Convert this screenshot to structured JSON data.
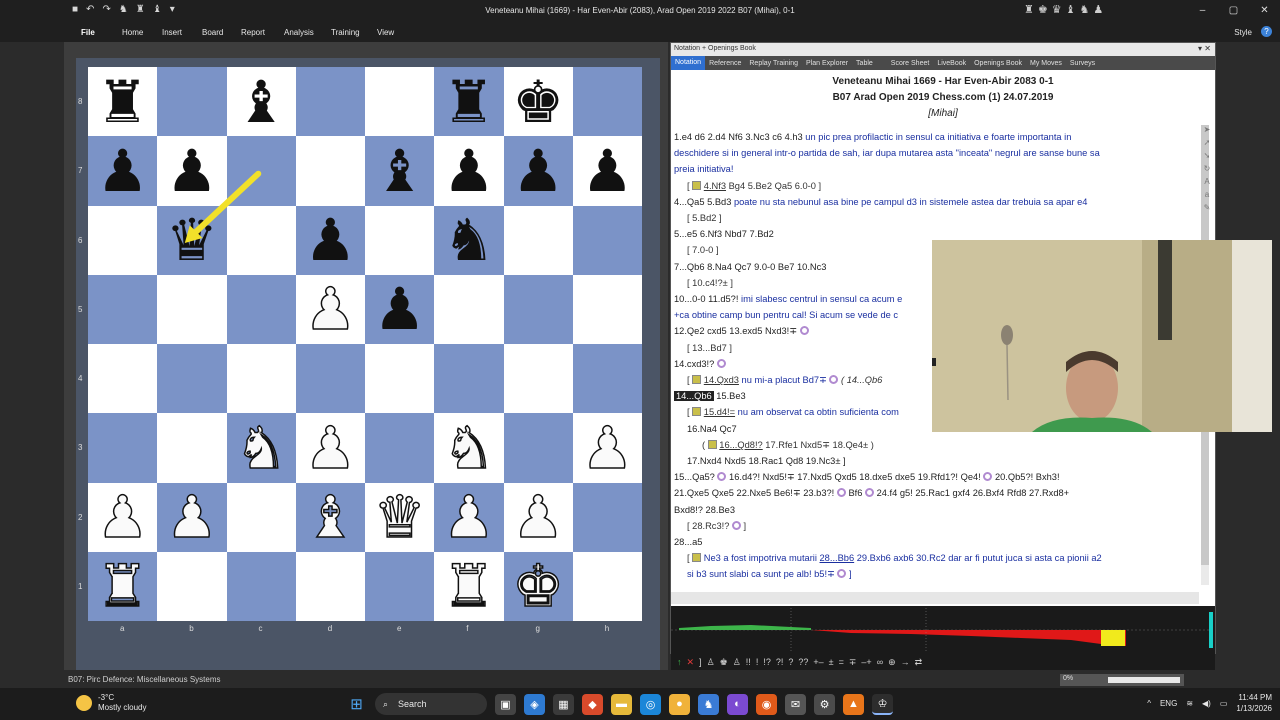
{
  "window": {
    "title": "Veneteanu Mihai (1669) - Har Even-Abir (2083), Arad Open 2019 2022 B07 (Mihai), 0-1",
    "controls": [
      "–",
      "▢",
      "✕"
    ]
  },
  "ribbon": {
    "file": "File",
    "tabs": [
      "Home",
      "Insert",
      "Board",
      "Report",
      "Analysis",
      "Training",
      "View"
    ],
    "style": "Style"
  },
  "board": {
    "files": [
      "a",
      "b",
      "c",
      "d",
      "e",
      "f",
      "g",
      "h"
    ],
    "ranks": [
      "8",
      "7",
      "6",
      "5",
      "4",
      "3",
      "2",
      "1"
    ],
    "position": [
      [
        "bR",
        "",
        "bB",
        "",
        "",
        "bR",
        "bK",
        ""
      ],
      [
        "bP",
        "bP",
        "",
        "",
        "bB",
        "bP",
        "bP",
        "bP"
      ],
      [
        "",
        "bQ",
        "",
        "bP",
        "",
        "bN",
        "",
        ""
      ],
      [
        "",
        "",
        "",
        "wP",
        "bP",
        "",
        "",
        ""
      ],
      [
        "",
        "",
        "",
        "",
        "",
        "",
        "",
        ""
      ],
      [
        "",
        "",
        "wN",
        "wP",
        "",
        "wN",
        "",
        "wP"
      ],
      [
        "wP",
        "wP",
        "",
        "wB",
        "wQ",
        "wP",
        "wP",
        ""
      ],
      [
        "wR",
        "",
        "",
        "",
        "",
        "wR",
        "wK",
        ""
      ]
    ],
    "arrow": {
      "from": "c7",
      "to": "b6",
      "color": "#f2e12a"
    }
  },
  "status_bar": "B07: Pirc Defence: Miscellaneous Systems",
  "notation": {
    "panel_title": "Notation + Openings Book",
    "tabs": [
      "Notation",
      "Reference",
      "Replay Training",
      "Plan Explorer",
      "Table",
      "Score Sheet",
      "LiveBook",
      "Openings Book",
      "My Moves",
      "Surveys"
    ],
    "header": {
      "players": "Veneteanu Mihai 1669 - Har Even-Abir 2083  0-1",
      "event": "B07 Arad Open 2019 Chess.com (1) 24.07.2019",
      "annotator": "[Mihai]"
    },
    "l1a": "1.e4  d6  2.d4  Nf6  3.Nc3  c6  4.h3",
    "l1b": "  un pic prea profilactic in sensul ca initiativa e foarte importanta in",
    "l2": "deschidere si in general intr-o partida de sah, iar dupa mutarea asta \"inceata\" negrul are sanse bune sa",
    "l3": "preia initiativa!",
    "l4a": "[",
    "l4b": "4.Nf3",
    "l4c": "  Bg4  5.Be2  Qa5  6.0-0 ]",
    "l5a": "4...Qa5  5.Bd3",
    "l5b": "  poate nu sta nebunul asa bine pe campul d3 in sistemele astea dar trebuia sa apar e4",
    "l6": "[ 5.Bd2 ]",
    "l7": "5...e5  6.Nf3  Nbd7  7.Bd2",
    "l8": "[ 7.0-0 ]",
    "l9": "7...Qb6  8.Na4  Qc7  9.0-0  Be7  10.Nc3",
    "l10": "[ 10.c4!?± ]",
    "l11a": "10...0-0  11.d5?!",
    "l11b": "  imi slabesc centrul in sensul ca acum e",
    "l12": "+ca obtine camp bun pentru cal! Si acum se vede de c",
    "l13": "12.Qe2  cxd5  13.exd5  Nxd3!∓",
    "l14": "[ 13...Bd7 ]",
    "l15": "14.cxd3!?",
    "l16a": "[",
    "l16b": "14.Qxd3",
    "l16c": "  nu mi-a placut  Bd7∓",
    "l16d": "( 14...Qb6",
    "l17a": "14...Qb6",
    "l17b": "  15.Be3",
    "l18a": "[",
    "l18b": "15.d4!=",
    "l18c": "  nu am observat ca obtin suficienta com",
    "l19": "16.Na4  Qc7",
    "l20a": "(",
    "l20b": "16...Qd8!?",
    "l20c": "  17.Rfe1  Nxd5∓  18.Qe4± )",
    "l21": "17.Nxd4  Nxd5  18.Rac1  Qd8  19.Nc3± ]",
    "l22a": "15...Qa5?",
    "l22b": "  16.d4?!  Nxd5!∓  17.Nxd5  Qxd5  18.dxe5  dxe5  19.Rfd1?!  Qe4!",
    "l22c": "  20.Qb5?!  Bxh3!",
    "l23": "21.Qxe5  Qxe5  22.Nxe5  Be6!∓  23.b3?!",
    "l23b": "  Bf6",
    "l23c": "  24.f4  g5!  25.Rac1  gxf4  26.Bxf4  Rfd8  27.Rxd8+",
    "l24": "Bxd8!?  28.Be3",
    "l25": "[ 28.Rc3!? ",
    "l26": "28...a5",
    "l27a": "[",
    "l27b": "  Ne3 a fost impotriva mutarii  ",
    "l27c": "28...Bb6",
    "l27d": "  29.Bxb6  axb6  30.Rc2 dar ar fi putut juca si asta ca pionii a2",
    "l28": "si b3 sunt slabi ca sunt pe alb!  b5!∓"
  },
  "graph_tools": [
    "↑",
    "✕",
    "]",
    "♙",
    "♚",
    "♙",
    "!!",
    "!",
    "!?",
    "?!",
    "?",
    "??",
    "+–",
    "±",
    "=",
    "∓",
    "–+",
    "∞",
    "⊕",
    "→",
    "⇄"
  ],
  "progress": {
    "label": "0%",
    "value": 0
  },
  "taskbar": {
    "temp": "-3°C",
    "condition": "Mostly cloudy",
    "search": "Search",
    "lang": "ENG",
    "time": "11:44 PM",
    "date": "1/13/2026"
  },
  "colors": {
    "light": "#ffffff",
    "dark": "#7b93c7",
    "accent": "#2f6fd0",
    "arrow": "#f2e12a"
  }
}
